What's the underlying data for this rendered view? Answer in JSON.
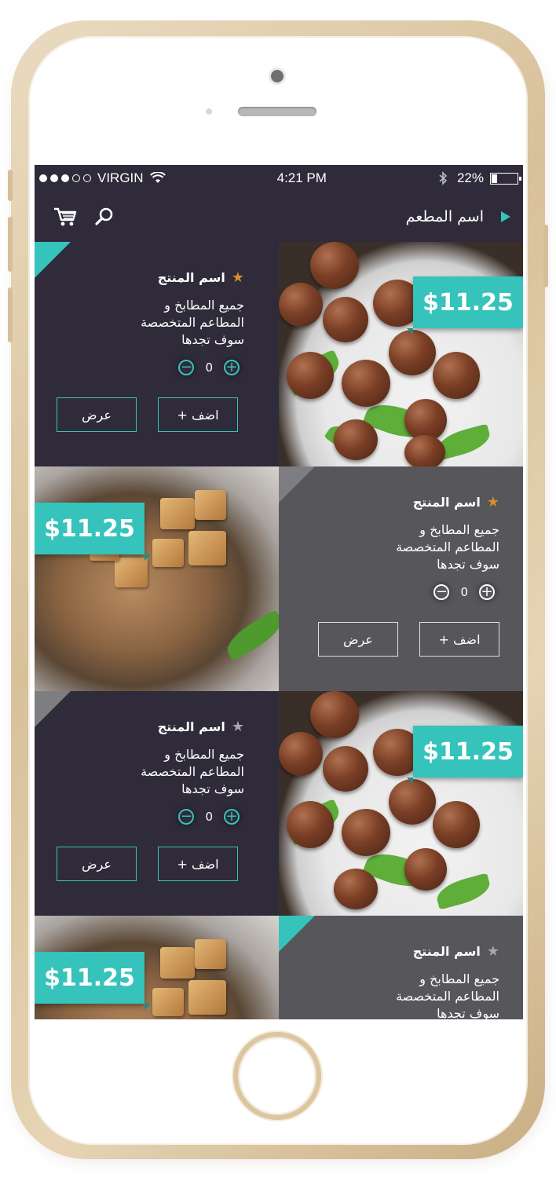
{
  "status_bar": {
    "carrier": "VIRGIN",
    "time": "4:21 PM",
    "battery_percent": "22%",
    "battery_level": 0.22
  },
  "nav": {
    "title": "اسم المطعم",
    "icons": [
      "cart-icon",
      "search-icon"
    ]
  },
  "products": [
    {
      "name": "اسم المنتج",
      "starred": true,
      "desc_lines": [
        "جميع المطابخ و",
        "المطاعم المتخصصة",
        "سوف تجدها"
      ],
      "qty": "0",
      "add_label": "+  اضف",
      "view_label": "عرض",
      "price": "$11.25",
      "image": "meatballs"
    },
    {
      "name": "اسم المنتج",
      "starred": true,
      "desc_lines": [
        "جميع المطابخ و",
        "المطاعم المتخصصة",
        "سوف تجدها"
      ],
      "qty": "0",
      "add_label": "+  اضف",
      "view_label": "عرض",
      "price": "$11.25",
      "image": "pork-chop"
    },
    {
      "name": "اسم المنتج",
      "starred": false,
      "desc_lines": [
        "جميع المطابخ و",
        "المطاعم المتخصصة",
        "سوف تجدها"
      ],
      "qty": "0",
      "add_label": "+  اضف",
      "view_label": "عرض",
      "price": "$11.25",
      "image": "meatballs"
    },
    {
      "name": "اسم المنتج",
      "starred": false,
      "desc_lines": [
        "جميع المطابخ و",
        "المطاعم المتخصصة",
        "سوف تجدها"
      ],
      "price": "$11.25",
      "image": "pork-chop"
    }
  ],
  "colors": {
    "accent": "#35c3bb",
    "dark_panel": "#2f2b3a",
    "grey_panel": "#57565b",
    "star_active": "#d88f2d",
    "star_inactive": "#a8a8ab"
  }
}
